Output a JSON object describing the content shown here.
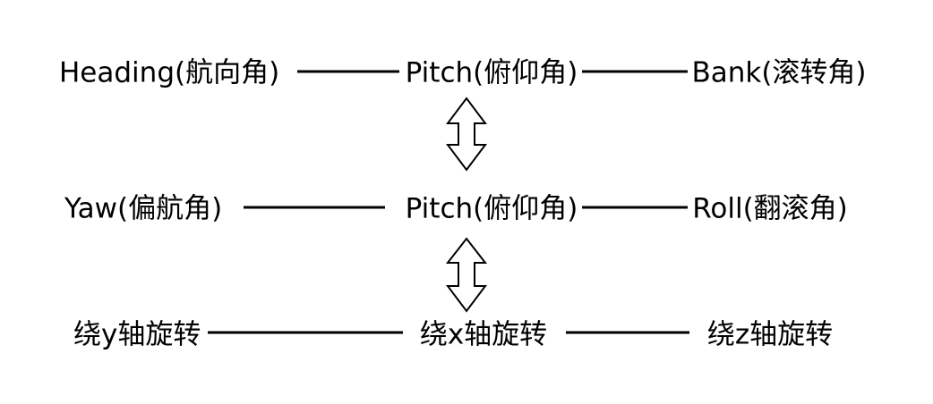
{
  "rows": [
    {
      "left": "Heading(航向角)",
      "middle": "Pitch(俯仰角)",
      "right": "Bank(滚转角)"
    },
    {
      "left": "Yaw(偏航角)",
      "middle": "Pitch(俯仰角)",
      "right": "Roll(翻滚角)"
    },
    {
      "left": "绕y轴旋转",
      "middle": "绕x轴旋转",
      "right": "绕z轴旋转"
    }
  ],
  "arrows": [
    {
      "name": "double-arrow-row1-row2"
    },
    {
      "name": "double-arrow-row2-row3"
    }
  ],
  "colors": {
    "line": "#000000",
    "arrow_fill": "#ffffff",
    "text": "#000000"
  }
}
